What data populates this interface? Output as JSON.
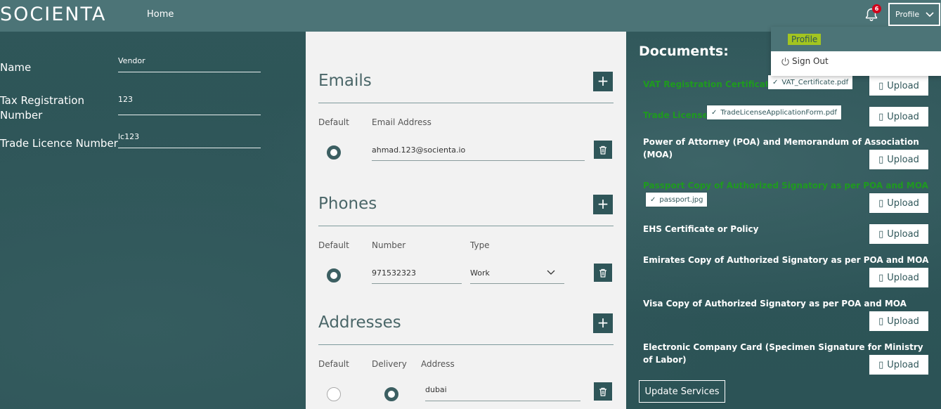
{
  "header": {
    "logo": "SOCIENTA",
    "nav_home": "Home",
    "notification_count": "6",
    "profile_label": "Profile"
  },
  "dropdown": {
    "profile": "Profile",
    "sign_out": "Sign Out"
  },
  "left": {
    "name_label": "Name",
    "name_value": "Vendor",
    "tax_label_1": "Tax Registration",
    "tax_label_2": "Number",
    "tax_value": "123",
    "trade_label": "Trade Licence Number",
    "trade_value": "lc123"
  },
  "emails": {
    "title": "Emails",
    "col_default": "Default",
    "col_email": "Email Address",
    "value": "ahmad.123@socienta.io"
  },
  "phones": {
    "title": "Phones",
    "col_default": "Default",
    "col_number": "Number",
    "col_type": "Type",
    "number": "971532323",
    "type": "Work"
  },
  "addresses": {
    "title": "Addresses",
    "col_default": "Default",
    "col_delivery": "Delivery",
    "col_address": "Address",
    "value": "dubai"
  },
  "documents": {
    "title": "Documents:",
    "upload_label": "Upload",
    "items": [
      {
        "label": "VAT Registration Certificate",
        "file": "VAT_Certificate.pdf"
      },
      {
        "label": "Trade License",
        "file": "TradeLicenseApplicationForm.pdf"
      },
      {
        "label": "Power of Attorney (POA) and Memorandum of Association (MOA)"
      },
      {
        "label": "Passport Copy of Authorized Signatory as per POA and MOA",
        "file": "passport.jpg"
      },
      {
        "label": "EHS Certificate or Policy"
      },
      {
        "label": "Emirates Copy of Authorized Signatory as per POA and MOA"
      },
      {
        "label": "Visa Copy of Authorized Signatory as per POA and MOA"
      },
      {
        "label": "Electronic Company Card (Specimen Signature for Ministry of Labor)"
      }
    ],
    "update_button": "Update Services"
  },
  "colors": {
    "header": "#4c7477",
    "panel": "#2e5558",
    "accent": "#a3c520",
    "uploaded_green": "#1f9a1f"
  }
}
